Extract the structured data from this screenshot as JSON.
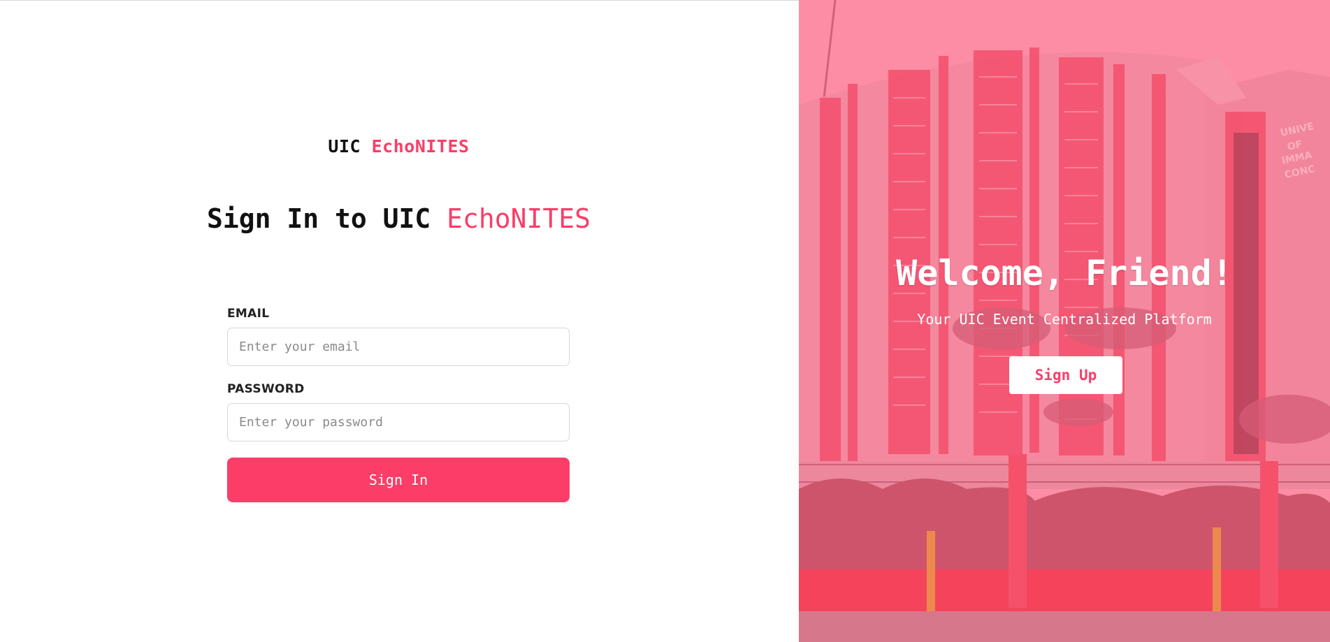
{
  "brand": {
    "prefix": "UIC",
    "name": "EchoNITES"
  },
  "heading": {
    "prefix": "Sign In to UIC",
    "name": "EchoNITES"
  },
  "form": {
    "email_label": "EMAIL",
    "email_placeholder": "Enter your email",
    "email_value": "",
    "password_label": "PASSWORD",
    "password_placeholder": "Enter your password",
    "password_value": "",
    "submit_label": "Sign In"
  },
  "hero": {
    "title": "Welcome, Friend!",
    "subtitle": "Your UIC Event Centralized Platform",
    "signup_label": "Sign Up",
    "image_icon": "campus-building-photo"
  },
  "colors": {
    "accent": "#fb3d68",
    "text": "#111111",
    "hero_tint": "#fc9aaa"
  }
}
